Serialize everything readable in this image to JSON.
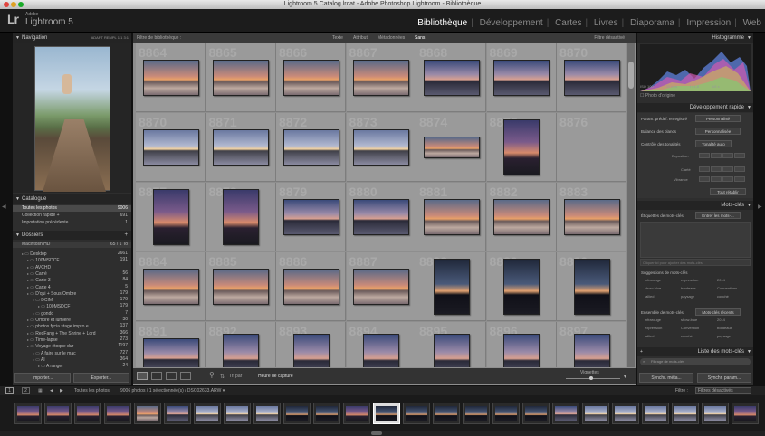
{
  "window": {
    "title": "Lightroom 5 Catalog.lrcat - Adobe Photoshop Lightroom - Bibliothèque"
  },
  "identity": {
    "logo": "Lr",
    "brand": "Adobe",
    "app": "Lightroom 5"
  },
  "modules": [
    "Bibliothèque",
    "Développement",
    "Cartes",
    "Livres",
    "Diaporama",
    "Impression",
    "Web"
  ],
  "left": {
    "navigator": {
      "title": "Navigation",
      "zoom": [
        "ADAPT",
        "REMPL",
        "1:1",
        "3:1"
      ]
    },
    "catalog": {
      "title": "Catalogue",
      "items": [
        {
          "label": "Toutes les photos",
          "count": "9006"
        },
        {
          "label": "Collection rapide +",
          "count": "691"
        },
        {
          "label": "Importation précédente",
          "count": "1"
        }
      ]
    },
    "folders": {
      "title": "Dossiers",
      "volume": "Macintosh HD",
      "volume_info": "65 / 1 To",
      "items": [
        {
          "label": "Desktop",
          "count": "2661"
        },
        {
          "label": "100MSDCF",
          "count": "191"
        },
        {
          "label": "AVCHD",
          "count": ""
        },
        {
          "label": "Carré",
          "count": "56"
        },
        {
          "label": "Carte 3",
          "count": "84"
        },
        {
          "label": "Carte 4",
          "count": "5"
        },
        {
          "label": "D'qui + Sous Ombre",
          "count": "179"
        },
        {
          "label": "DCIM",
          "count": "179"
        },
        {
          "label": "100MSDCF",
          "count": "179"
        },
        {
          "label": "gondo",
          "count": "7"
        },
        {
          "label": "Ombre et lumière",
          "count": "30"
        },
        {
          "label": "photos fycia stage impro e...",
          "count": "137"
        },
        {
          "label": "RedFang + The Shrine + Lord",
          "count": "366"
        },
        {
          "label": "Time-lapse",
          "count": "273"
        },
        {
          "label": "Voyage étoque dur",
          "count": "1197"
        },
        {
          "label": "A faire sur le mac",
          "count": "727"
        },
        {
          "label": "AI",
          "count": "364"
        },
        {
          "label": "A ranger",
          "count": "24"
        }
      ]
    },
    "import_btn": "Importer...",
    "export_btn": "Exporter..."
  },
  "filter": {
    "title": "Filtre de bibliothèque :",
    "options": [
      "Texte",
      "Attribut",
      "Métadonnées",
      "Sans"
    ],
    "preset": "Filtre désactivé"
  },
  "grid": {
    "rows": [
      {
        "nums": [
          "8864",
          "8865",
          "8866",
          "8867",
          "8868",
          "8869",
          "8870"
        ]
      },
      {
        "nums": [
          "8870",
          "8871",
          "8872",
          "8873",
          "8874",
          "8875",
          "8876"
        ]
      },
      {
        "nums": [
          "8877",
          "8878",
          "8879",
          "8880",
          "8881",
          "8882",
          "8883"
        ]
      },
      {
        "nums": [
          "8884",
          "8885",
          "8886",
          "8887",
          "8888",
          "8889",
          "8890"
        ]
      },
      {
        "nums": [
          "8891",
          "8892",
          "8893",
          "8894",
          "8895",
          "8896",
          "8897"
        ]
      }
    ]
  },
  "toolbar": {
    "sort_label": "Tri par :",
    "sort_value": "Heure de capture",
    "thumb_label": "Vignettes"
  },
  "filmstrip_header": {
    "page1": "1",
    "page2": "2",
    "source": "Toutes les photos",
    "info": "9006 photos / 1 sélectionnée(s) / DSC02633.ARW ▾",
    "filter_label": "Filtre :",
    "filter_value": "Filtres désactivés"
  },
  "right": {
    "histogram": {
      "title": "Histogramme",
      "iso": "ISO 100",
      "focal": "35 mm",
      "aperture": "f / 1,8",
      "shutter": "1/8 s",
      "original": "Photo d'origine"
    },
    "quick_develop": {
      "title": "Développement rapide",
      "preset_label": "Param. prédef. enregistré",
      "preset_value": "Personnalisé",
      "wb_label": "Balance des blancs",
      "wb_value": "Personnalisée",
      "tone_label": "Contrôle des tonalités",
      "tone_value": "Tonalité auto",
      "exposure": "Exposition",
      "clarity": "Clarté",
      "vibrance": "Vibrance",
      "reset": "Tout rétablir"
    },
    "keywords": {
      "title": "Mots-clés",
      "tags_label": "Étiquettes de mots-clés",
      "tags_value": "Entrer les mots-...",
      "placeholder": "Cliquer ici pour ajouter des mots-clés",
      "suggestions_label": "Suggestions de mots-clés",
      "suggestions": [
        "infrarouge",
        "expression",
        "2014",
        "show-blue",
        "bordeaux",
        "Conventions",
        "tallied",
        "paysage",
        "couché"
      ],
      "set_label": "Ensemble de mots-clés",
      "set_value": "Mots-clés récents",
      "set_items": [
        "infrarouge",
        "show-blue",
        "2014",
        "expression",
        "Convention",
        "bordeaux",
        "tallied",
        "couché",
        "paysage"
      ]
    },
    "keyword_list": {
      "title": "Liste des mots-clés",
      "filter_placeholder": "Filtrage de mots-clés"
    },
    "sync_btn": "Synchr. méta...",
    "sync_settings_btn": "Synchr. param..."
  }
}
